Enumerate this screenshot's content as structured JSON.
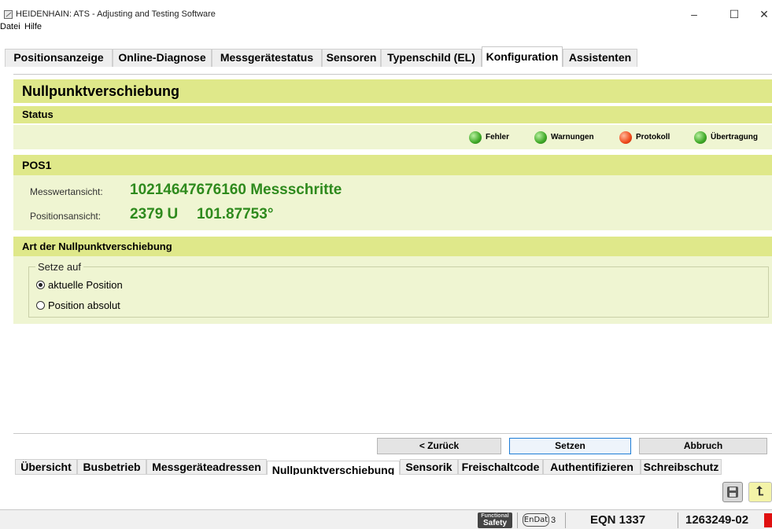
{
  "window": {
    "title": "HEIDENHAIN: ATS - Adjusting and Testing Software",
    "min_glyph": "–",
    "max_glyph": "☐",
    "close_glyph": "✕"
  },
  "menu": [
    "Datei",
    "Hilfe"
  ],
  "top_tabs": [
    "Positionsanzeige",
    "Online-Diagnose",
    "Messgerätestatus",
    "Sensoren",
    "Typenschild (EL)",
    "Konfiguration",
    "Assistenten"
  ],
  "top_tab_active": "Konfiguration",
  "page": {
    "title": "Nullpunktverschiebung",
    "status_header": "Status",
    "status_indicators": [
      {
        "label": "Fehler",
        "color": "green",
        "icon": "led-green-icon"
      },
      {
        "label": "Warnungen",
        "color": "green",
        "icon": "led-green-icon"
      },
      {
        "label": "Protokoll",
        "color": "red",
        "icon": "led-red-icon"
      },
      {
        "label": "Übertragung",
        "color": "green",
        "icon": "led-green-icon"
      }
    ],
    "pos_header": "POS1",
    "measure_label": "Messwertansicht:",
    "measure_value": "10214647676160 Messschritte",
    "position_label": "Positionsansicht:",
    "position_turns": "2379 U",
    "position_angle": "101.87753°",
    "art_header": "Art der Nullpunktverschiebung",
    "group_title": "Setze auf",
    "radio_current": "aktuelle Position",
    "radio_absolute": "Position absolut",
    "radio_selected": "aktuelle Position"
  },
  "buttons": {
    "back": "< Zurück",
    "set": "Setzen",
    "cancel": "Abbruch"
  },
  "bottom_tabs": [
    "Übersicht",
    "Busbetrieb",
    "Messgeräteadressen",
    "Nullpunktverschiebung",
    "Sensorik",
    "Freischaltcode",
    "Authentifizieren",
    "Schreibschutz"
  ],
  "bottom_tab_active": "Nullpunktverschiebung",
  "toolbar": {
    "save_icon": "floppy-disk-icon",
    "exit_icon": "exit-arrow-icon",
    "exit_glyph": "⮤"
  },
  "statusbar": {
    "functional_safety_line1": "Functional",
    "functional_safety_line2": "Safety",
    "endat_label": "EnDat",
    "endat_version": "3",
    "device": "EQN 1337",
    "id": "1263249-02"
  },
  "colors": {
    "header_bg": "#dfe88a",
    "section_bg": "#eff5d2",
    "value_green": "#2e8a1d",
    "set_button_border": "#1e7dd6"
  }
}
